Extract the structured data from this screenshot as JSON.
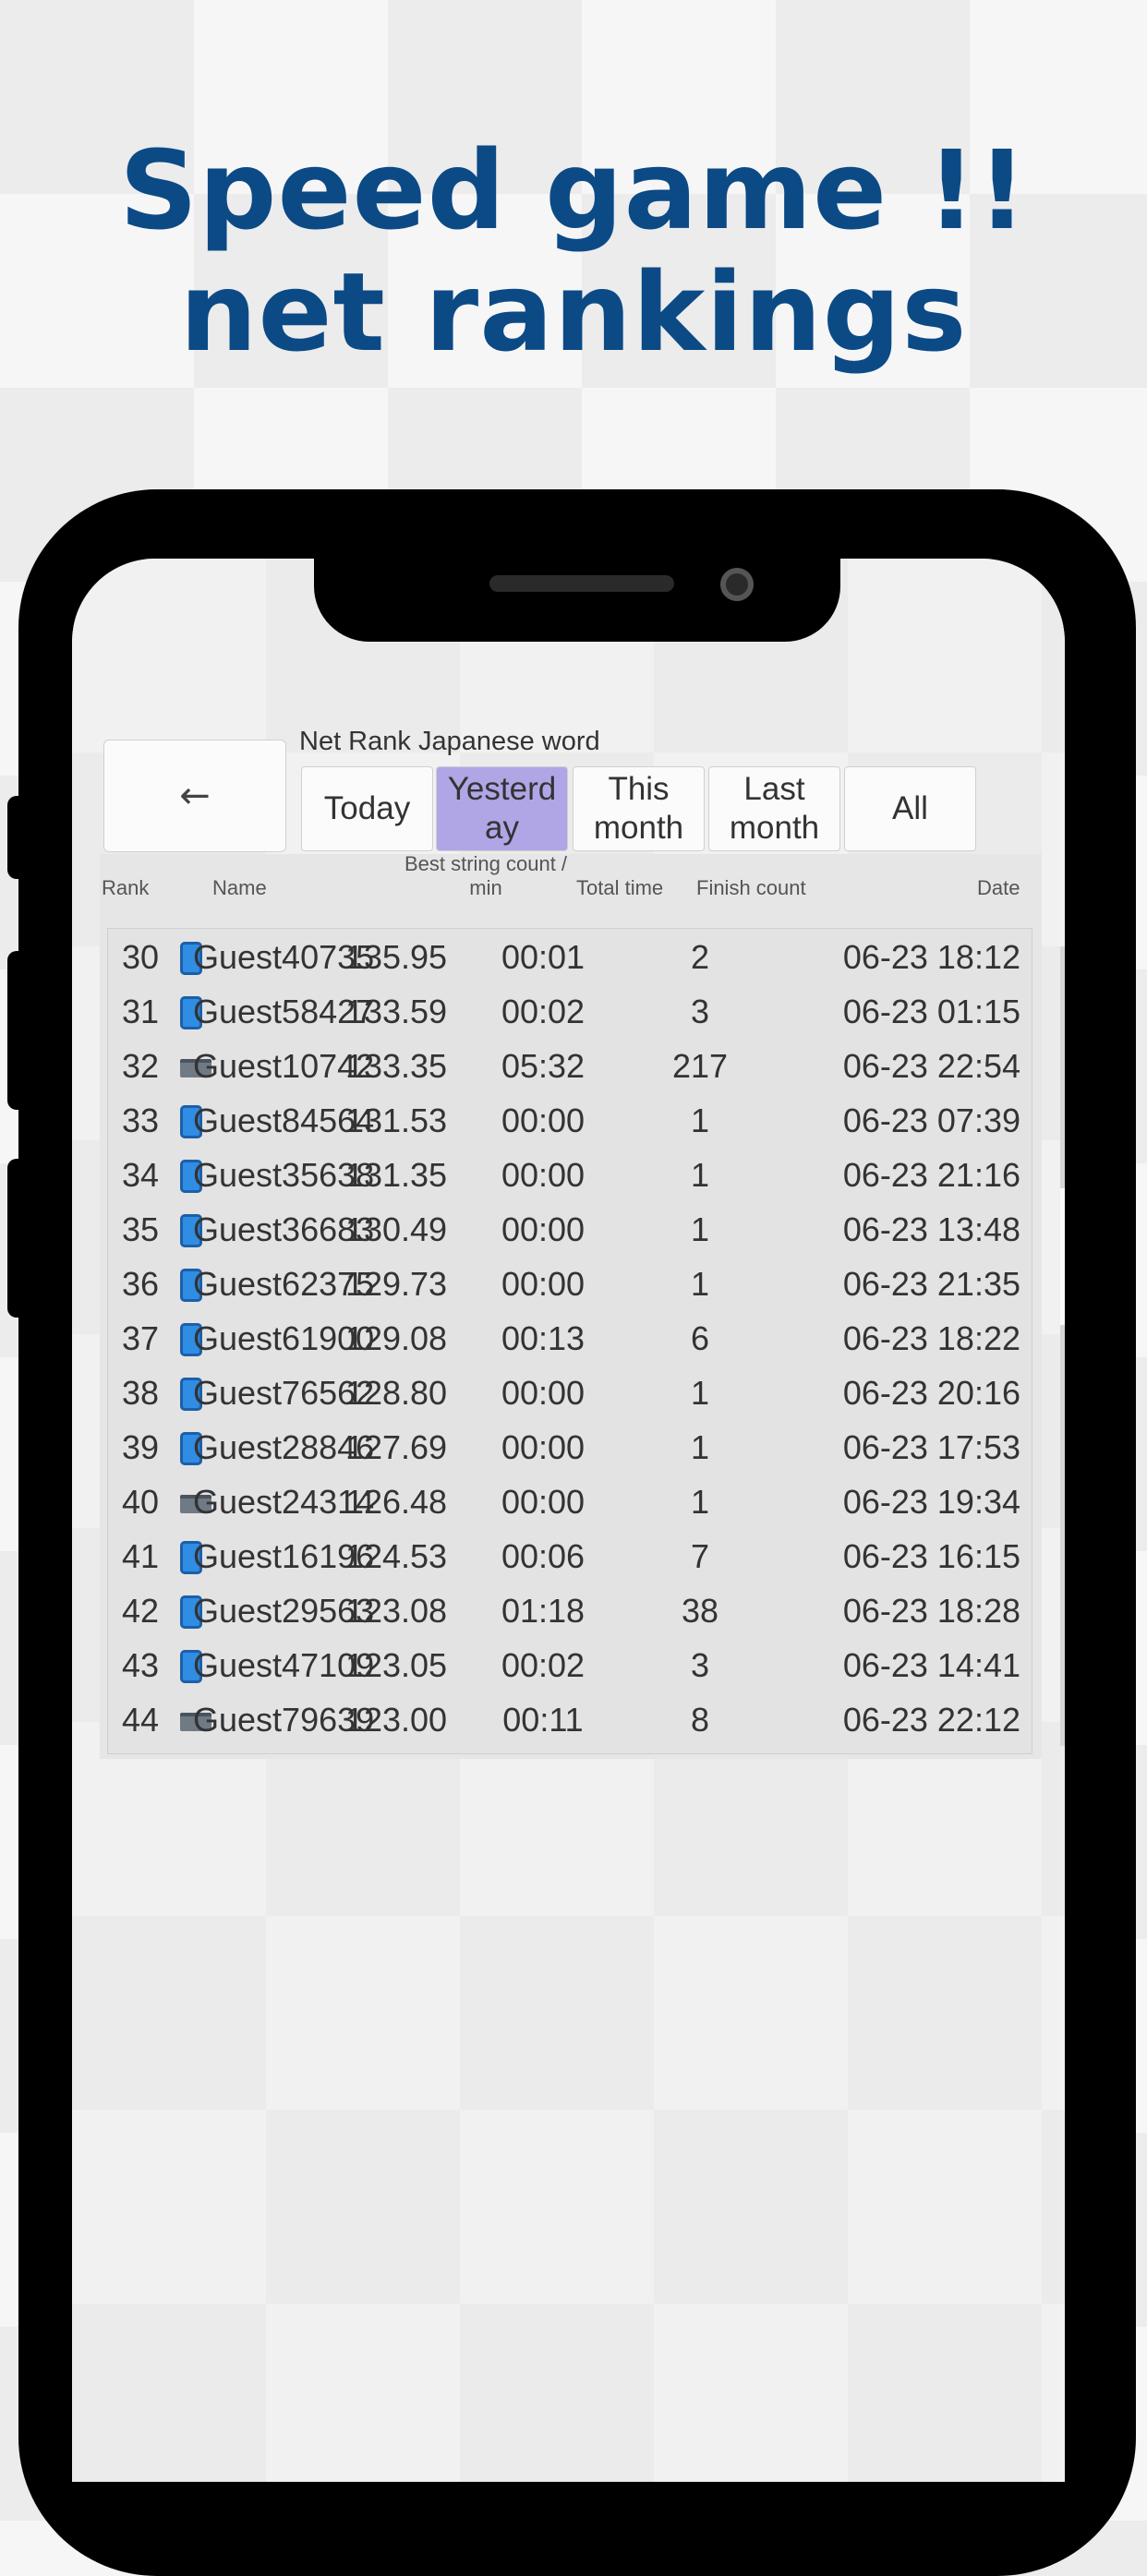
{
  "headline": {
    "line1": "Speed game !!",
    "line2": "net rankings"
  },
  "screen": {
    "back_label": "←",
    "title": "Net Rank Japanese word",
    "tabs": [
      {
        "line1": "Today",
        "line2": "",
        "active": false
      },
      {
        "line1": "Yesterd",
        "line2": "ay",
        "active": true
      },
      {
        "line1": "This",
        "line2": "month",
        "active": false
      },
      {
        "line1": "Last",
        "line2": "month",
        "active": false
      },
      {
        "line1": "All",
        "line2": "",
        "active": false
      }
    ],
    "columns": {
      "rank": "Rank",
      "name": "Name",
      "best_line1": "Best string count /",
      "best_line2": "min",
      "total": "Total time",
      "finish": "Finish count",
      "date": "Date"
    },
    "rows": [
      {
        "rank": "30",
        "device": "phone",
        "name": "Guest40735",
        "best": "135.95",
        "time": "00:01",
        "finish": "2",
        "date": "06-23 18:12"
      },
      {
        "rank": "31",
        "device": "phone",
        "name": "Guest58427",
        "best": "133.59",
        "time": "00:02",
        "finish": "3",
        "date": "06-23 01:15"
      },
      {
        "rank": "32",
        "device": "pc",
        "name": "Guest10742",
        "best": "133.35",
        "time": "05:32",
        "finish": "217",
        "date": "06-23 22:54"
      },
      {
        "rank": "33",
        "device": "phone",
        "name": "Guest84564",
        "best": "131.53",
        "time": "00:00",
        "finish": "1",
        "date": "06-23 07:39"
      },
      {
        "rank": "34",
        "device": "phone",
        "name": "Guest35638",
        "best": "131.35",
        "time": "00:00",
        "finish": "1",
        "date": "06-23 21:16"
      },
      {
        "rank": "35",
        "device": "phone",
        "name": "Guest36683",
        "best": "130.49",
        "time": "00:00",
        "finish": "1",
        "date": "06-23 13:48"
      },
      {
        "rank": "36",
        "device": "phone",
        "name": "Guest62375",
        "best": "129.73",
        "time": "00:00",
        "finish": "1",
        "date": "06-23 21:35"
      },
      {
        "rank": "37",
        "device": "phone",
        "name": "Guest61900",
        "best": "129.08",
        "time": "00:13",
        "finish": "6",
        "date": "06-23 18:22"
      },
      {
        "rank": "38",
        "device": "phone",
        "name": "Guest76562",
        "best": "128.80",
        "time": "00:00",
        "finish": "1",
        "date": "06-23 20:16"
      },
      {
        "rank": "39",
        "device": "phone",
        "name": "Guest28846",
        "best": "127.69",
        "time": "00:00",
        "finish": "1",
        "date": "06-23 17:53"
      },
      {
        "rank": "40",
        "device": "pc",
        "name": "Guest24314",
        "best": "126.48",
        "time": "00:00",
        "finish": "1",
        "date": "06-23 19:34"
      },
      {
        "rank": "41",
        "device": "phone",
        "name": "Guest16196",
        "best": "124.53",
        "time": "00:06",
        "finish": "7",
        "date": "06-23 16:15"
      },
      {
        "rank": "42",
        "device": "phone",
        "name": "Guest29563",
        "best": "123.08",
        "time": "01:18",
        "finish": "38",
        "date": "06-23 18:28"
      },
      {
        "rank": "43",
        "device": "phone",
        "name": "Guest47109",
        "best": "123.05",
        "time": "00:02",
        "finish": "3",
        "date": "06-23 14:41"
      },
      {
        "rank": "44",
        "device": "pc",
        "name": "Guest79639",
        "best": "123.00",
        "time": "00:11",
        "finish": "8",
        "date": "06-23 22:12"
      }
    ],
    "colors": {
      "headline": "#0c4a86",
      "active_tab": "#b0a6e6",
      "phone_icon": "#2f8de4"
    }
  }
}
